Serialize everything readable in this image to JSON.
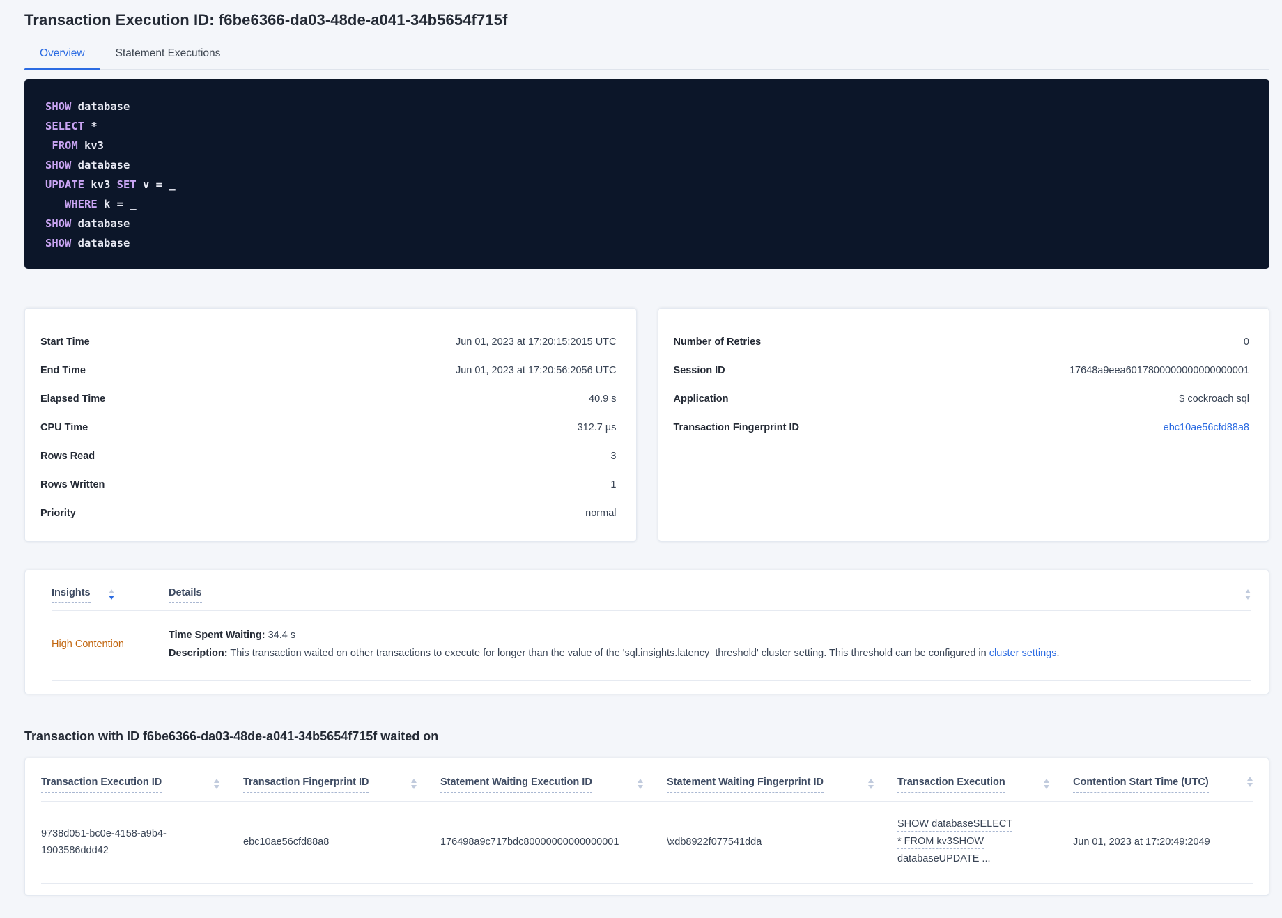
{
  "header": {
    "title": "Transaction Execution ID: f6be6366-da03-48de-a041-34b5654f715f"
  },
  "tabs": {
    "overview": "Overview",
    "statement_executions": "Statement Executions"
  },
  "colors": {
    "accent_blue": "#2b6be2",
    "insight_orange": "#c2660f",
    "code_keyword": "#c9a4f2",
    "code_background": "#0c1629"
  },
  "sql_box": {
    "lines": [
      {
        "segs": [
          {
            "t": "SHOW",
            "c": "kw"
          },
          {
            "t": " database",
            "c": "pl"
          }
        ]
      },
      {
        "segs": [
          {
            "t": "SELECT",
            "c": "kw"
          },
          {
            "t": " *",
            "c": "pl"
          }
        ]
      },
      {
        "segs": [
          {
            "t": " ",
            "c": "pl"
          },
          {
            "t": "FROM",
            "c": "kw"
          },
          {
            "t": " kv3",
            "c": "pl"
          }
        ]
      },
      {
        "segs": [
          {
            "t": "SHOW",
            "c": "kw"
          },
          {
            "t": " database",
            "c": "pl"
          }
        ]
      },
      {
        "segs": [
          {
            "t": "UPDATE",
            "c": "kw"
          },
          {
            "t": " kv3 ",
            "c": "pl"
          },
          {
            "t": "SET",
            "c": "kw"
          },
          {
            "t": " v = _",
            "c": "pl"
          }
        ]
      },
      {
        "segs": [
          {
            "t": "   ",
            "c": "pl"
          },
          {
            "t": "WHERE",
            "c": "kw"
          },
          {
            "t": " k = _",
            "c": "pl"
          }
        ]
      },
      {
        "segs": [
          {
            "t": "SHOW",
            "c": "kw"
          },
          {
            "t": " database",
            "c": "pl"
          }
        ]
      },
      {
        "segs": [
          {
            "t": "SHOW",
            "c": "kw"
          },
          {
            "t": " database",
            "c": "pl"
          }
        ]
      }
    ]
  },
  "summary_left": {
    "rows": [
      {
        "label": "Start Time",
        "value": "Jun 01, 2023 at 17:20:15:2015 UTC"
      },
      {
        "label": "End Time",
        "value": "Jun 01, 2023 at 17:20:56:2056 UTC"
      },
      {
        "label": "Elapsed Time",
        "value": "40.9 s"
      },
      {
        "label": "CPU Time",
        "value": "312.7 µs"
      },
      {
        "label": "Rows Read",
        "value": "3"
      },
      {
        "label": "Rows Written",
        "value": "1"
      },
      {
        "label": "Priority",
        "value": "normal"
      }
    ]
  },
  "summary_right": {
    "rows": [
      {
        "label": "Number of Retries",
        "value": "0"
      },
      {
        "label": "Session ID",
        "value": "17648a9eea6017800000000000000001"
      },
      {
        "label": "Application",
        "value": "$ cockroach sql"
      },
      {
        "label": "Transaction Fingerprint ID",
        "value": "ebc10ae56cfd88a8",
        "link": true
      }
    ]
  },
  "insights": {
    "col_insights": "Insights",
    "col_details": "Details",
    "row": {
      "insight": "High Contention",
      "waiting_label": "Time Spent Waiting:",
      "waiting_value": "34.4 s",
      "description_label": "Description:",
      "description_text": "This transaction waited on other transactions to execute for longer than the value of the 'sql.insights.latency_threshold' cluster setting. This threshold can be configured in ",
      "description_link": "cluster settings",
      "description_suffix": "."
    }
  },
  "waited": {
    "heading": "Transaction with ID f6be6366-da03-48de-a041-34b5654f715f waited on",
    "columns": [
      "Transaction Execution ID",
      "Transaction Fingerprint ID",
      "Statement Waiting Execution ID",
      "Statement Waiting Fingerprint ID",
      "Transaction Execution",
      "Contention Start Time (UTC)"
    ],
    "row": {
      "transaction_execution_id": "9738d051-bc0e-4158-a9b4-1903586ddd42",
      "transaction_fingerprint_id": "ebc10ae56cfd88a8",
      "statement_waiting_execution_id": "176498a9c717bdc80000000000000001",
      "statement_waiting_fingerprint_id": "\\xdb8922f077541dda",
      "transaction_execution": "SHOW databaseSELECT * FROM kv3SHOW databaseUPDATE ...",
      "contention_start_time": "Jun 01, 2023 at 17:20:49:2049"
    }
  }
}
